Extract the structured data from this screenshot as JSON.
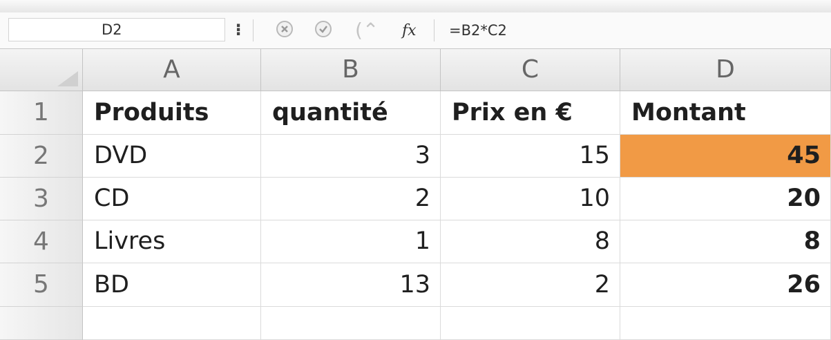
{
  "formula_bar": {
    "name_box": "D2",
    "formula": "=B2*C2",
    "fx_label": "fx"
  },
  "icons": [
    "stepper-icon",
    "cancel-icon",
    "confirm-icon",
    "insert-function-icon",
    "select-all-icon"
  ],
  "colors": {
    "selected_cell": "#f19a45"
  },
  "columns": [
    "A",
    "B",
    "C",
    "D"
  ],
  "rows": [
    {
      "number": "1",
      "cells": [
        "Produits",
        "quantité",
        "Prix en €",
        "Montant"
      ]
    },
    {
      "number": "2",
      "cells": [
        "DVD",
        "3",
        "15",
        "45"
      ]
    },
    {
      "number": "3",
      "cells": [
        "CD",
        "2",
        "10",
        "20"
      ]
    },
    {
      "number": "4",
      "cells": [
        "Livres",
        "1",
        "8",
        "8"
      ]
    },
    {
      "number": "5",
      "cells": [
        "BD",
        "13",
        "2",
        "26"
      ]
    }
  ],
  "selected_cell": "D2"
}
